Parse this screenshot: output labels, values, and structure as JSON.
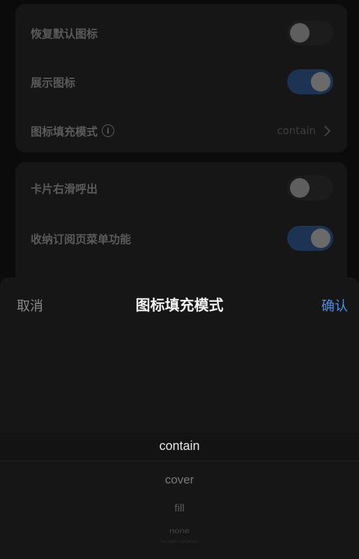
{
  "settings_card_1": {
    "rows": [
      {
        "label": "恢复默认图标",
        "toggle": false
      },
      {
        "label": "展示图标",
        "toggle": true
      },
      {
        "label": "图标填充模式",
        "value": "contain"
      }
    ]
  },
  "settings_card_2": {
    "rows": [
      {
        "label": "卡片右滑呼出",
        "toggle": false
      },
      {
        "label": "收纳订阅页菜单功能",
        "toggle": true
      }
    ]
  },
  "picker_sheet": {
    "cancel_label": "取消",
    "title": "图标填充模式",
    "confirm_label": "确认",
    "options": [
      "contain",
      "cover",
      "fill",
      "none",
      "scale-down"
    ],
    "selected": "contain"
  },
  "colors": {
    "accent": "#4a8fe8",
    "toggle_on": "#1d3354",
    "sheet_bg": "#161616"
  },
  "icons": {
    "info": "info-circle-icon",
    "chevron": "chevron-right-icon"
  }
}
